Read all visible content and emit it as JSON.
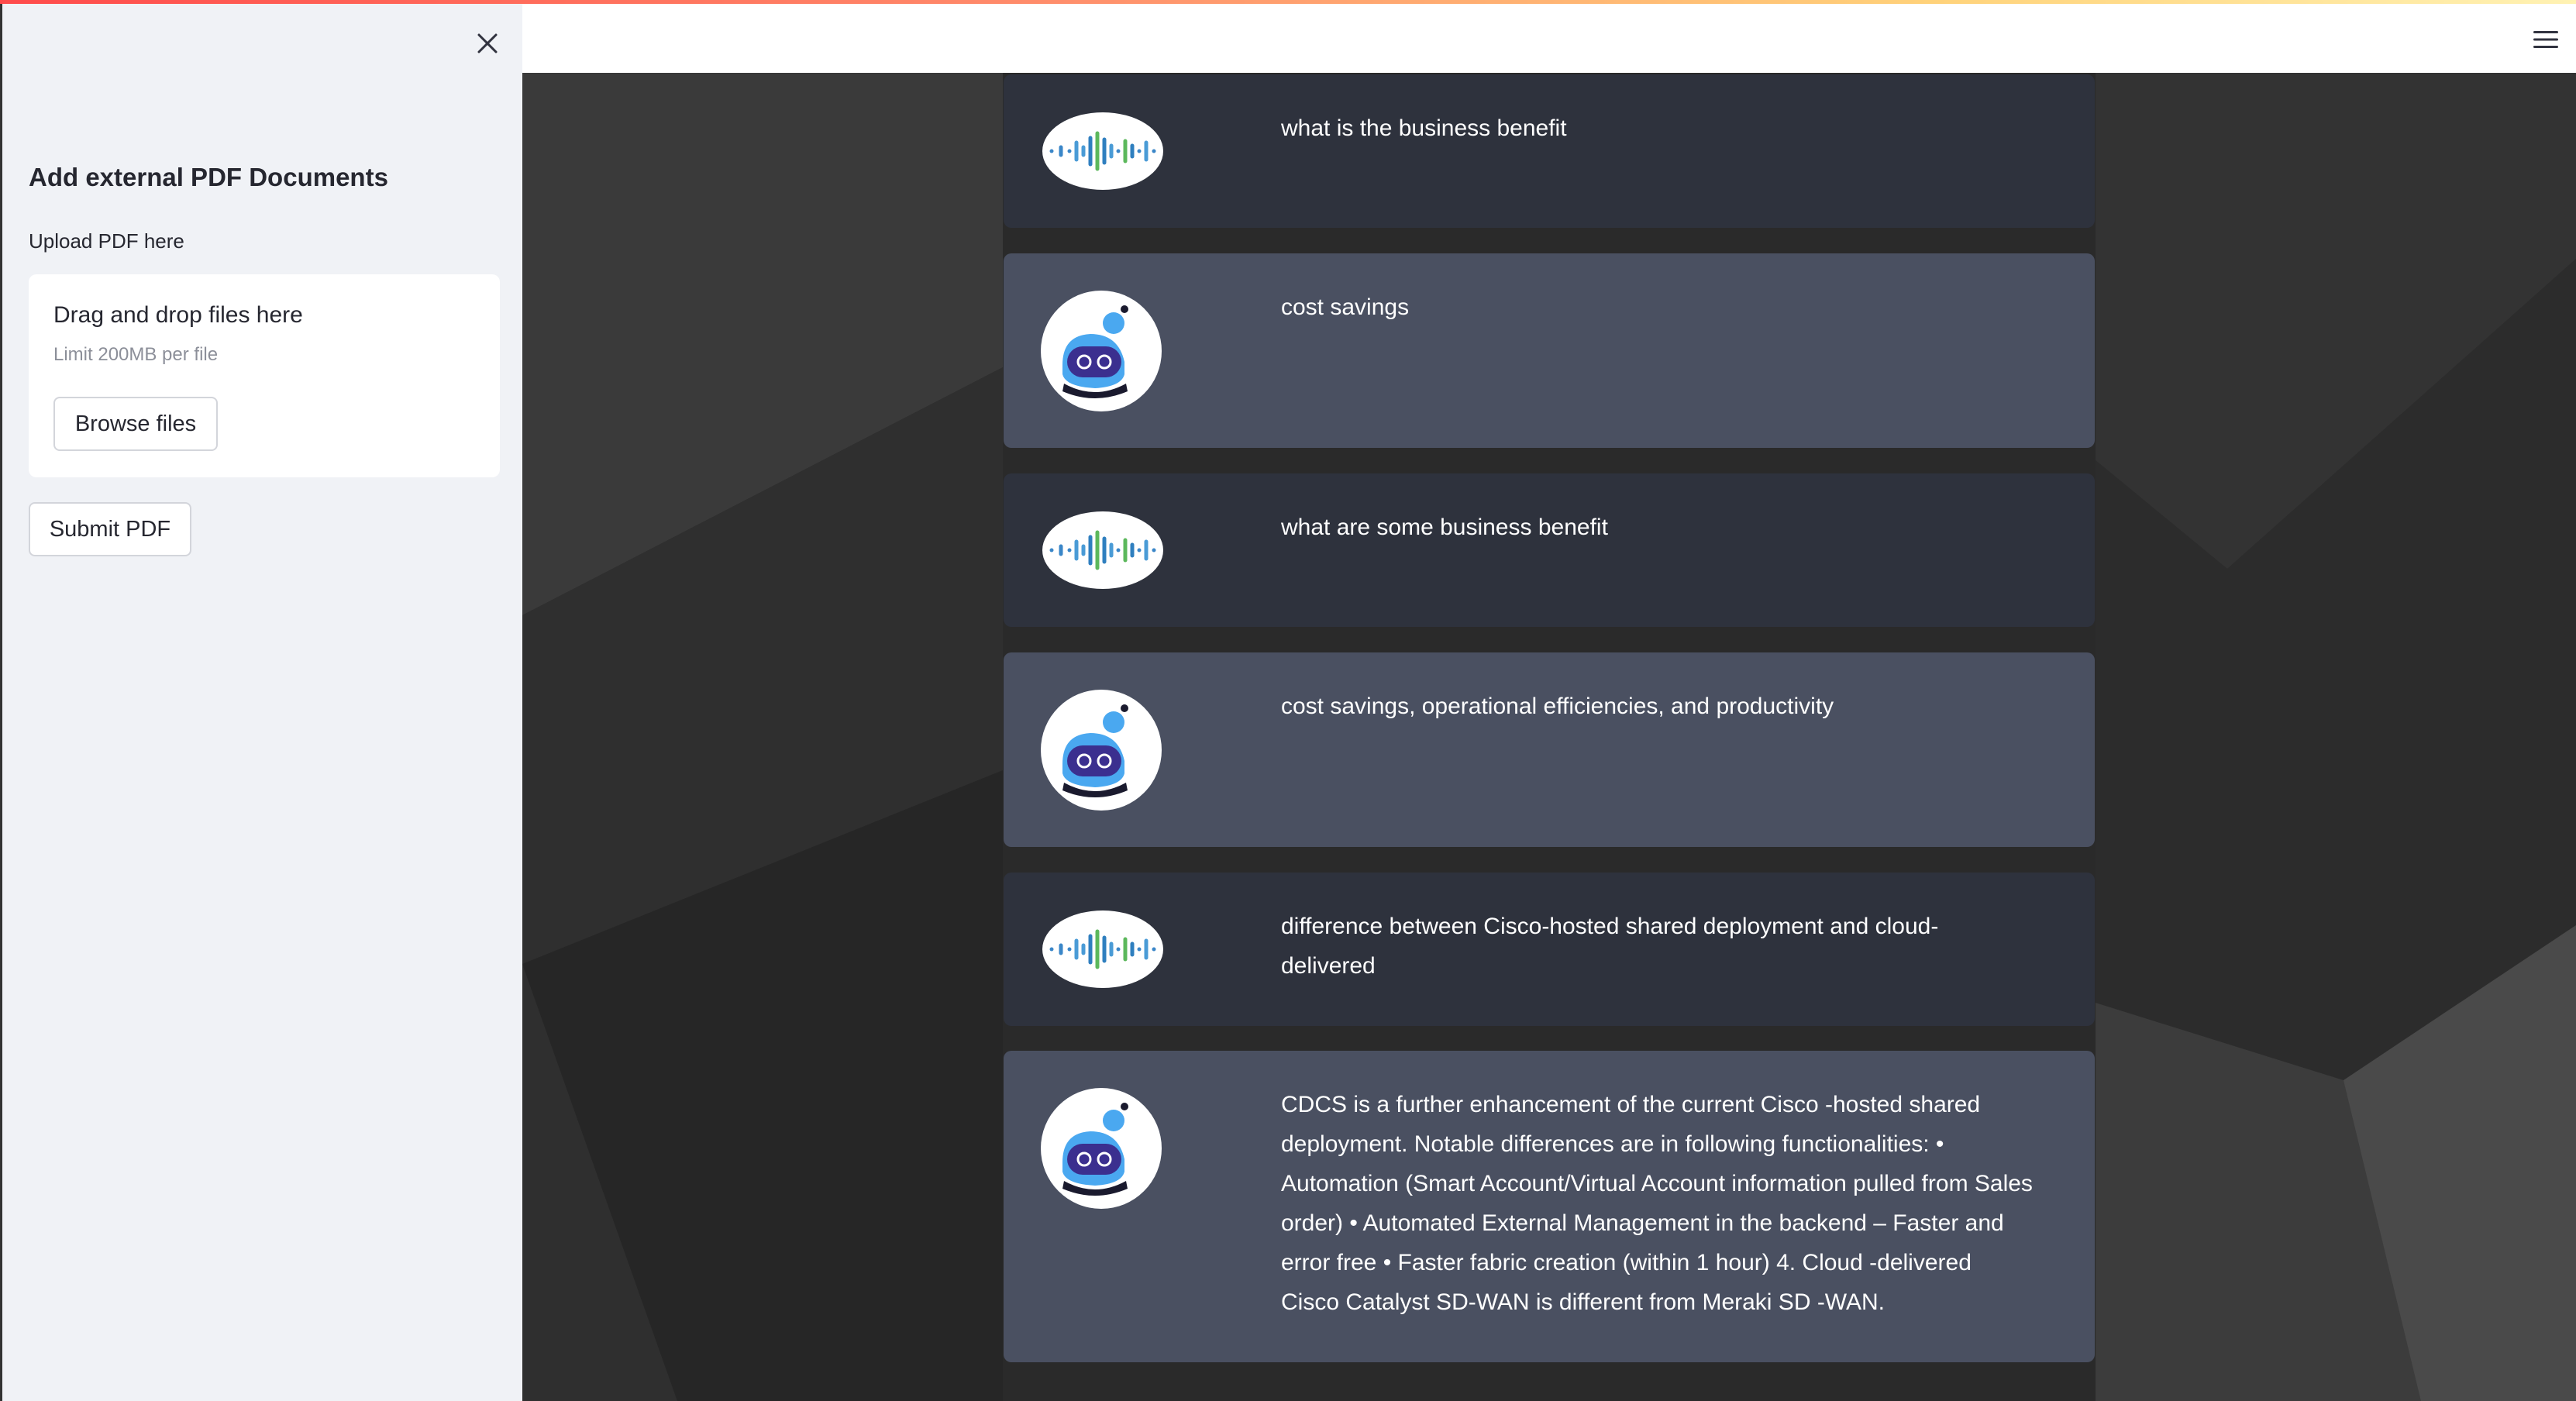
{
  "sidebar": {
    "title": "Add external PDF Documents",
    "upload_label": "Upload PDF here",
    "dropzone": {
      "title": "Drag and drop files here",
      "limit": "Limit 200MB per file",
      "browse_label": "Browse files"
    },
    "submit_label": "Submit PDF",
    "close_icon": "close-icon"
  },
  "header": {
    "menu_icon": "hamburger-menu-icon"
  },
  "colors": {
    "sidebar_bg": "#f0f2f6",
    "user_bubble": "#2e323d",
    "bot_bubble": "#4a5061",
    "accent": "#ff4b4b"
  },
  "messages": [
    {
      "role": "user",
      "avatar": "voice-wave-icon",
      "text": "what is the business benefit"
    },
    {
      "role": "assistant",
      "avatar": "robot-icon",
      "text": "cost savings"
    },
    {
      "role": "user",
      "avatar": "voice-wave-icon",
      "text": "what are some business benefit"
    },
    {
      "role": "assistant",
      "avatar": "robot-icon",
      "text": "cost savings, operational efficiencies, and productivity"
    },
    {
      "role": "user",
      "avatar": "voice-wave-icon",
      "text": "difference between Cisco-hosted shared deployment and cloud-delivered"
    },
    {
      "role": "assistant",
      "avatar": "robot-icon",
      "text": "CDCS is a further enhancement of the current Cisco -hosted shared deployment. Notable differences are in following functionalities: • Automation (Smart Account/Virtual Account information pulled from Sales order) • Automated External Management in the backend – Faster and error free • Faster fabric creation (within 1 hour) 4. Cloud -delivered Cisco Catalyst SD-WAN is different from Meraki SD -WAN."
    }
  ]
}
